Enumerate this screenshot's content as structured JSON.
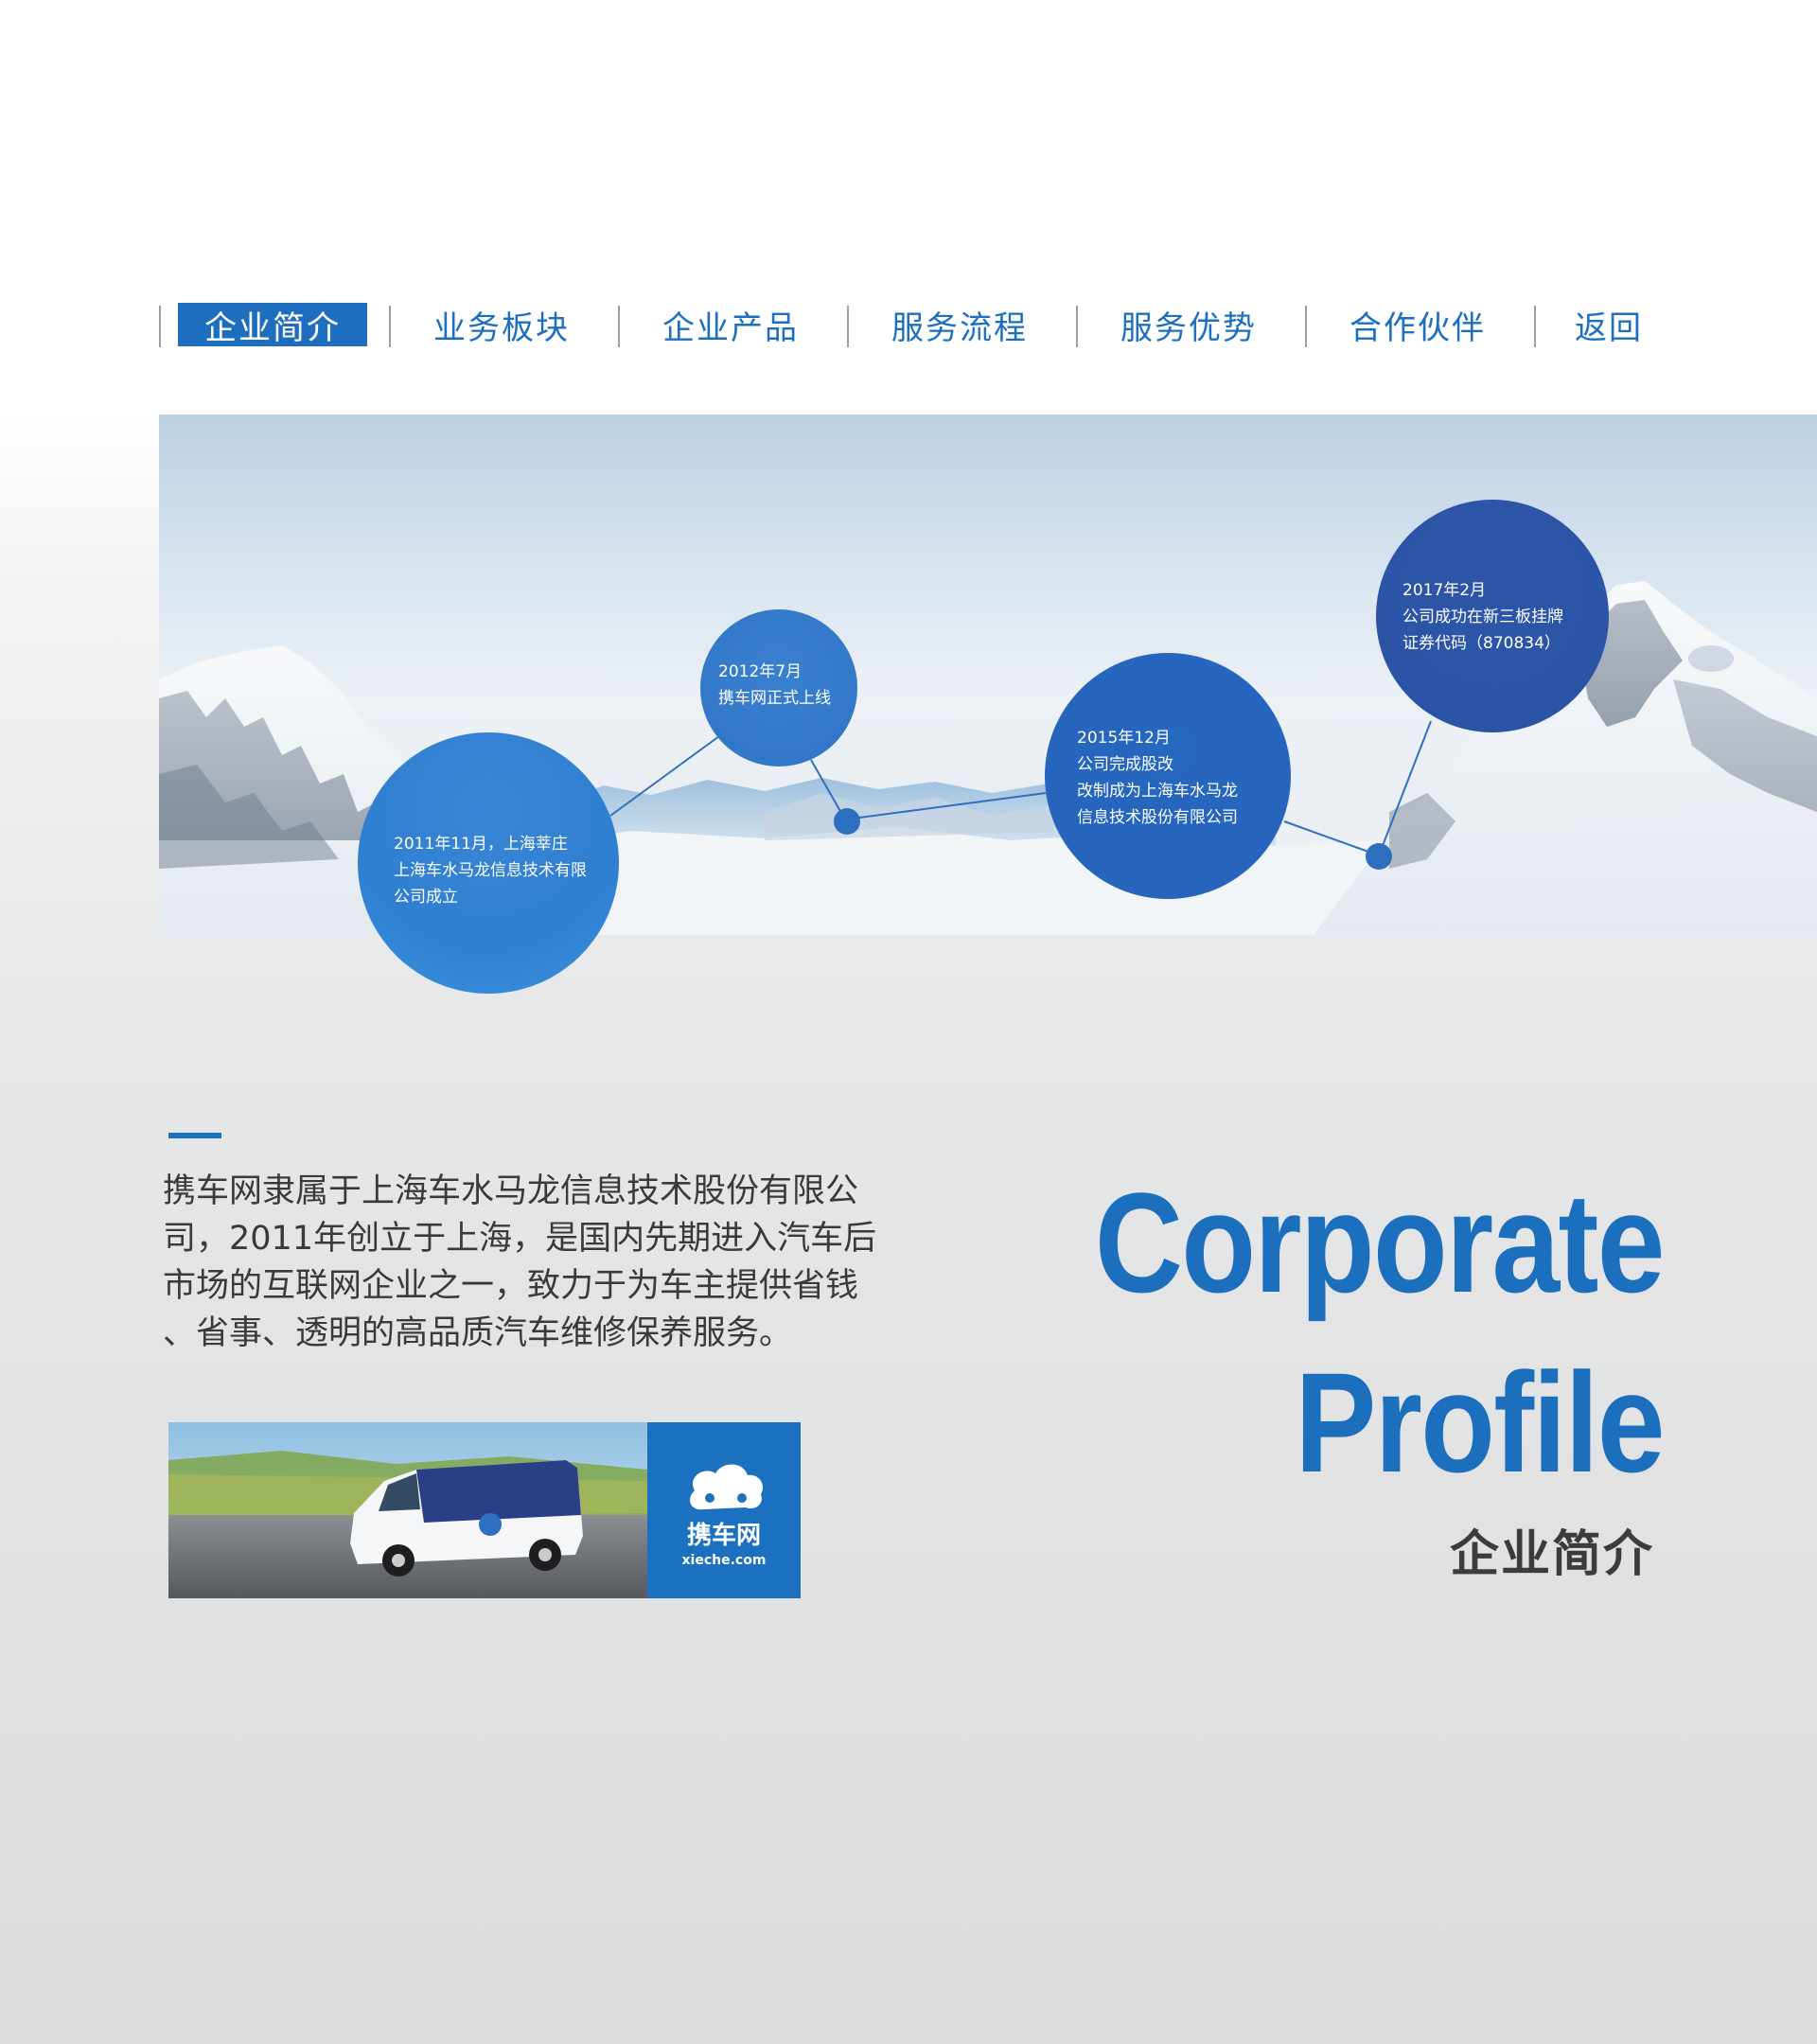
{
  "nav": {
    "items": [
      {
        "label": "企业简介",
        "active": true
      },
      {
        "label": "业务板块",
        "active": false
      },
      {
        "label": "企业产品",
        "active": false
      },
      {
        "label": "服务流程",
        "active": false
      },
      {
        "label": "服务优势",
        "active": false
      },
      {
        "label": "合作伙伴",
        "active": false
      },
      {
        "label": "返回",
        "active": false
      }
    ]
  },
  "timeline": [
    {
      "lines": [
        "2011年11月，上海莘庄",
        "上海车水马龙信息技术有限",
        "公司成立"
      ]
    },
    {
      "lines": [
        "2012年7月",
        "携车网正式上线"
      ]
    },
    {
      "lines": [
        "2015年12月",
        "公司完成股改",
        "改制成为上海车水马龙",
        "信息技术股份有限公司"
      ]
    },
    {
      "lines": [
        "2017年2月",
        "公司成功在新三板挂牌",
        "证券代码（870834）"
      ]
    }
  ],
  "profile": {
    "intro_lines": [
      "携车网隶属于上海车水马龙信息技术股份有限公",
      "司，2011年创立于上海，是国内先期进入汽车后",
      "市场的互联网企业之一，致力于为车主提供省钱",
      "、省事、透明的高品质汽车维修保养服务。"
    ],
    "title_en_line1": "Corporate",
    "title_en_line2": "Profile",
    "title_cn": "企业简介"
  },
  "logo": {
    "name": "携车网",
    "domain": "xieche.com"
  },
  "colors": {
    "brand_blue": "#1b6fbd",
    "nav_active_bg": "#1d6ebe",
    "text_dark": "#3a3a3a"
  }
}
